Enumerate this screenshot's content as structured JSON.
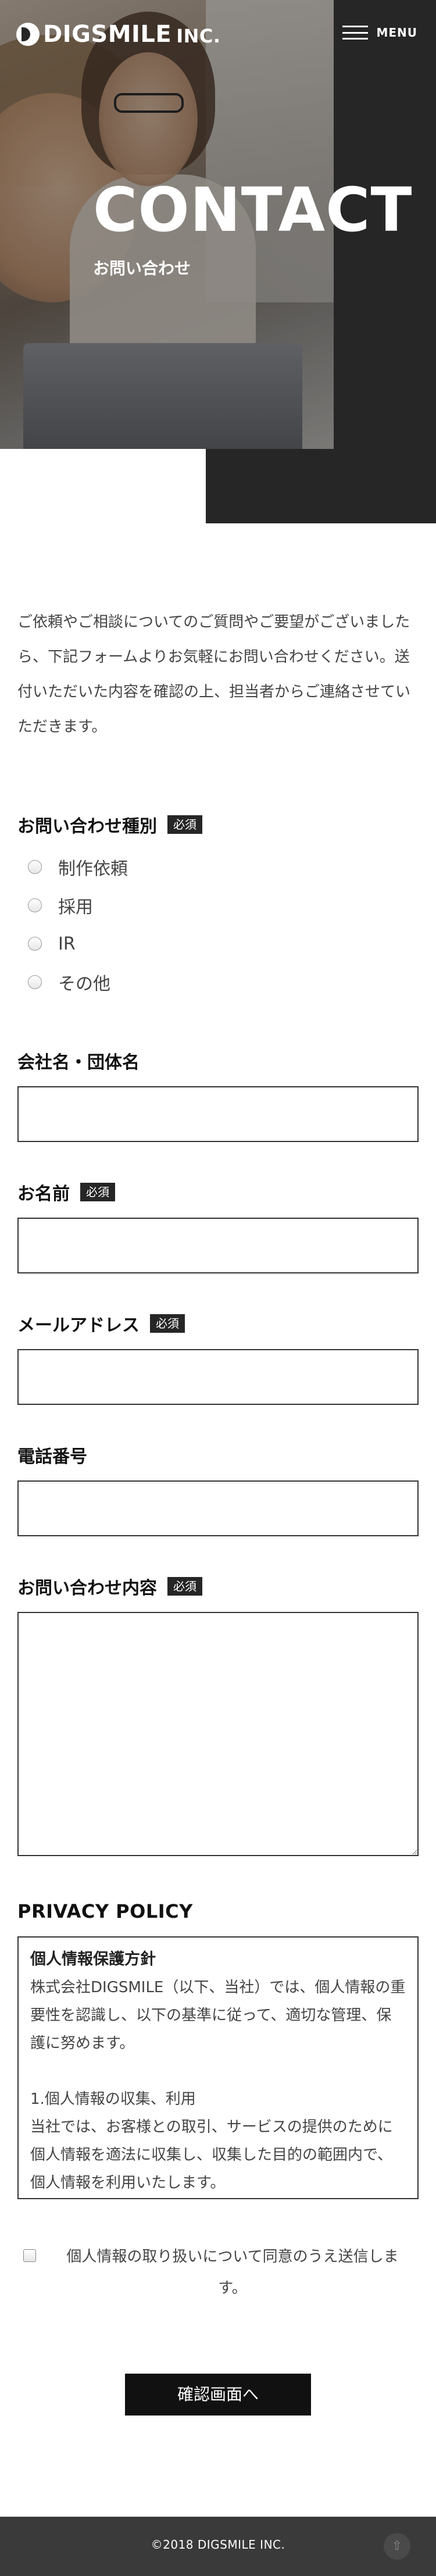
{
  "header": {
    "logo_text": "DIGSMILE",
    "logo_suffix": "INC.",
    "menu_label": "MENU"
  },
  "hero": {
    "title": "CONTACT",
    "subtitle": "お問い合わせ"
  },
  "intro": {
    "text": "ご依頼やご相談についてのご質問やご要望がございましたら、下記フォームよりお気軽にお問い合わせください。送付いただいた内容を確認の上、担当者からご連絡させていただきます。"
  },
  "form": {
    "required_badge": "必須",
    "inquiry_type": {
      "label": "お問い合わせ種別",
      "options": [
        "制作依頼",
        "採用",
        "IR",
        "その他"
      ]
    },
    "company": {
      "label": "会社名・団体名",
      "value": ""
    },
    "name": {
      "label": "お名前",
      "value": ""
    },
    "email": {
      "label": "メールアドレス",
      "value": ""
    },
    "phone": {
      "label": "電話番号",
      "value": ""
    },
    "message": {
      "label": "お問い合わせ内容",
      "value": ""
    }
  },
  "privacy": {
    "title": "PRIVACY POLICY",
    "heading": "個人情報保護方針",
    "paragraph1": "株式会社DIGSMILE（以下、当社）では、個人情報の重要性を認識し、以下の基準に従って、適切な管理、保護に努めます。",
    "section1_title": "1.個人情報の収集、利用",
    "section1_text": "当社では、お客様との取引、サービスの提供のために個人情報を適法に収集し、収集した目的の範囲内で、個人情報を利用いたします。"
  },
  "consent": {
    "label": "個人情報の取り扱いについて同意のうえ送信します。",
    "checked": false
  },
  "submit": {
    "label": "確認画面へ"
  },
  "footer": {
    "copyright": "©2018 DIGSMILE INC.",
    "pagetop_icon": "arrow-up-icon"
  }
}
